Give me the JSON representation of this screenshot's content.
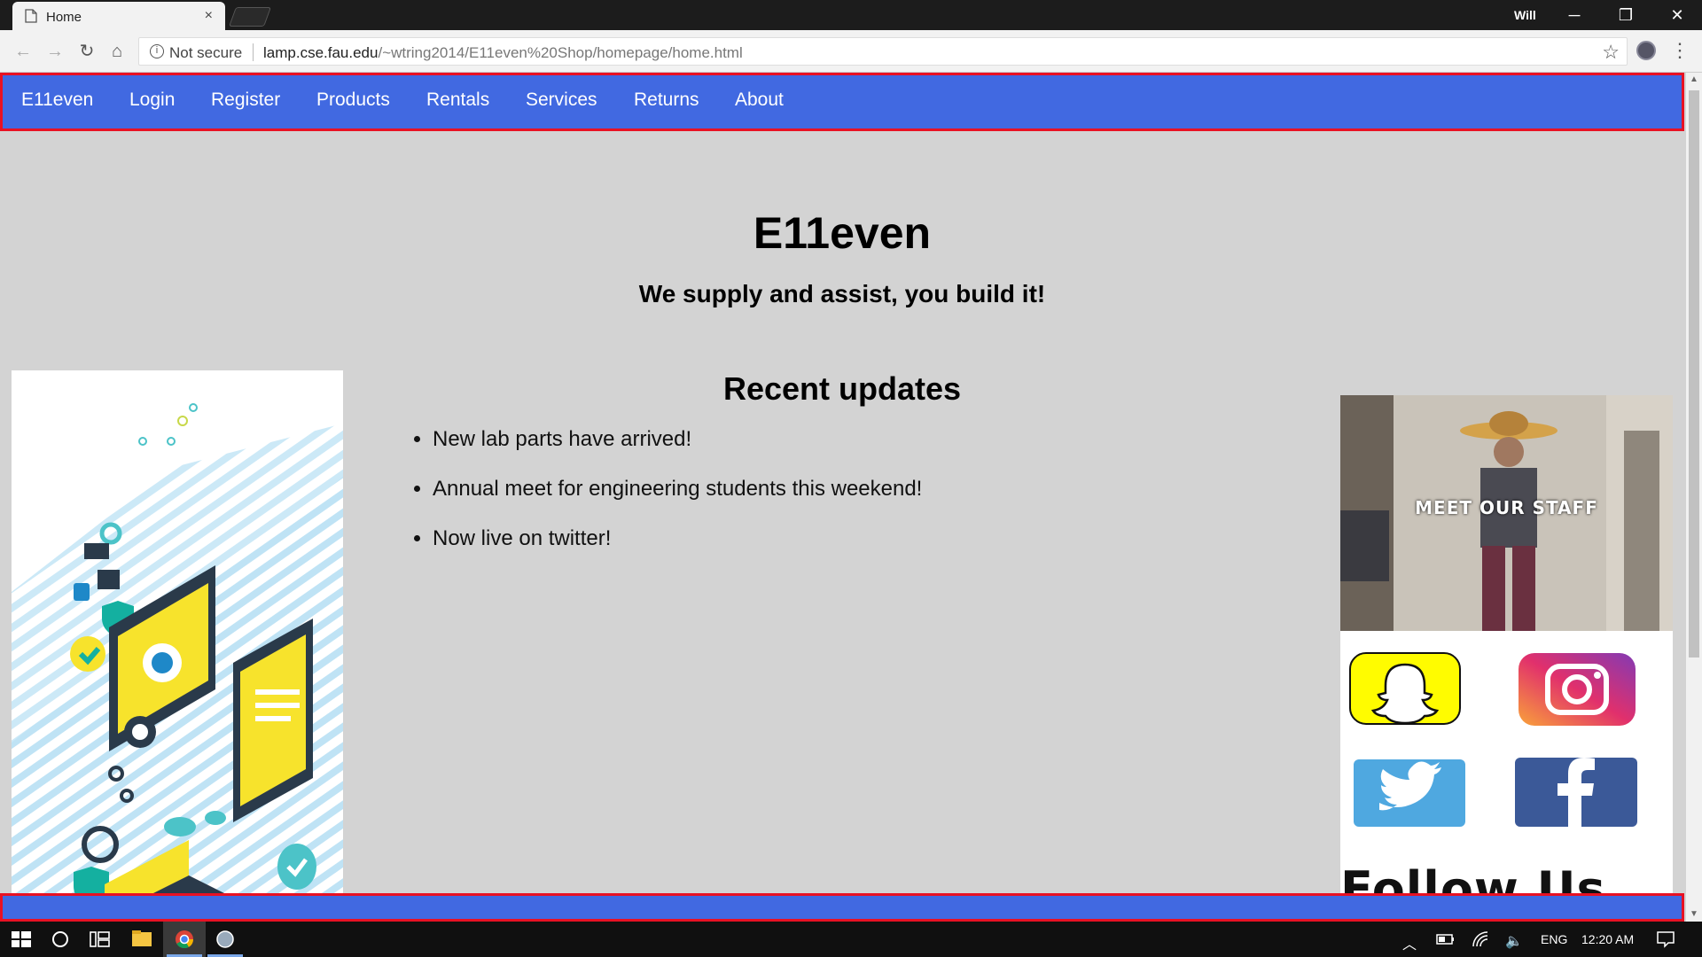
{
  "browser": {
    "tab_title": "Home",
    "tab_close": "×",
    "profile_name": "Will",
    "window_controls": {
      "minimize": "─",
      "restore": "❐",
      "close": "✕"
    },
    "nav": {
      "back": "←",
      "forward": "→",
      "reload": "↻",
      "home": "⌂"
    },
    "security_label": "Not secure",
    "url_host": "lamp.cse.fau.edu",
    "url_path": "/~wtring2014/E11even%20Shop/homepage/home.html",
    "bookmark_star": "☆",
    "menu": "⋮"
  },
  "site": {
    "nav_links": [
      "E11even",
      "Login",
      "Register",
      "Products",
      "Rentals",
      "Services",
      "Returns",
      "About"
    ],
    "title": "E11even",
    "tagline": "We supply and assist, you build it!",
    "updates_heading": "Recent updates",
    "updates": [
      "New lab parts have arrived!",
      "Annual meet for engineering students this weekend!",
      "Now live on twitter!"
    ],
    "staff_banner": "MEET OUR STAFF",
    "follow_text": "Follow Us",
    "social_icons": [
      "snapchat-icon",
      "instagram-icon",
      "twitter-icon",
      "facebook-icon"
    ],
    "colors": {
      "nav_bg": "#4169e1",
      "nav_border": "#e81123",
      "page_bg": "#d3d3d3"
    }
  },
  "taskbar": {
    "language": "ENG",
    "time": "12:20 AM"
  }
}
